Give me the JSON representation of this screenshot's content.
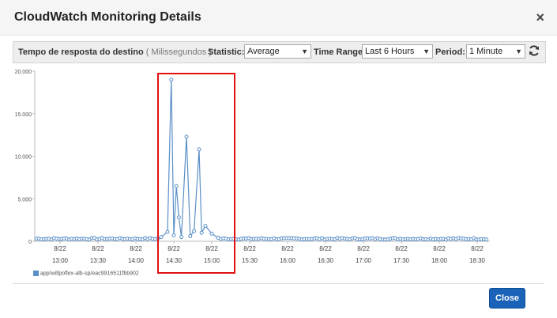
{
  "dialog": {
    "title": "CloudWatch Monitoring Details",
    "close_icon": "×"
  },
  "toolbar": {
    "metric_name": "Tempo de resposta do destino",
    "metric_unit": "( Milissegundos )",
    "statistic_label": "Statistic:",
    "statistic_value": "Average",
    "time_range_label": "Time Range:",
    "time_range_value": "Last 6 Hours",
    "period_label": "Period:",
    "period_value": "1 Minute",
    "refresh_icon": "refresh-icon"
  },
  "legend": {
    "series_name": "app/willpoflex-alb-sp/eac9916511fbb902"
  },
  "footer": {
    "close_label": "Close"
  },
  "colors": {
    "series": "#5b8fc7",
    "highlight": "#e01010",
    "close_button": "#1a63b8"
  },
  "chart_data": {
    "type": "line",
    "xlabel": "",
    "ylabel": "",
    "ylim": [
      0,
      20000
    ],
    "y_ticks": [
      "20.000",
      "15.000",
      "10.000",
      "5.000",
      "0"
    ],
    "x_ticks": [
      {
        "date": "8/22",
        "time": "13:00"
      },
      {
        "date": "8/22",
        "time": "13:30"
      },
      {
        "date": "8/22",
        "time": "14:00"
      },
      {
        "date": "8/22",
        "time": "14:30"
      },
      {
        "date": "8/22",
        "time": "15:00"
      },
      {
        "date": "8/22",
        "time": "15:30"
      },
      {
        "date": "8/22",
        "time": "16:00"
      },
      {
        "date": "8/22",
        "time": "16:30"
      },
      {
        "date": "8/22",
        "time": "17:00"
      },
      {
        "date": "8/22",
        "time": "17:30"
      },
      {
        "date": "8/22",
        "time": "18:00"
      },
      {
        "date": "8/22",
        "time": "18:30"
      }
    ],
    "x_range": [
      "12:40",
      "18:40"
    ],
    "grid": false,
    "legend_position": "bottom-left",
    "series": [
      {
        "name": "app/willpoflex-alb-sp/eac9916511fbb902",
        "baseline": 200,
        "points": [
          {
            "x": "13:00",
            "y": 200
          },
          {
            "x": "13:30",
            "y": 250
          },
          {
            "x": "14:00",
            "y": 200
          },
          {
            "x": "14:20",
            "y": 500
          },
          {
            "x": "14:25",
            "y": 1100
          },
          {
            "x": "14:28",
            "y": 19000
          },
          {
            "x": "14:30",
            "y": 700
          },
          {
            "x": "14:32",
            "y": 6500
          },
          {
            "x": "14:34",
            "y": 2800
          },
          {
            "x": "14:36",
            "y": 500
          },
          {
            "x": "14:40",
            "y": 12300
          },
          {
            "x": "14:43",
            "y": 600
          },
          {
            "x": "14:46",
            "y": 1200
          },
          {
            "x": "14:50",
            "y": 10800
          },
          {
            "x": "14:52",
            "y": 1000
          },
          {
            "x": "14:55",
            "y": 1800
          },
          {
            "x": "15:00",
            "y": 900
          },
          {
            "x": "15:05",
            "y": 400
          },
          {
            "x": "15:30",
            "y": 250
          },
          {
            "x": "16:00",
            "y": 200
          },
          {
            "x": "16:30",
            "y": 250
          },
          {
            "x": "17:00",
            "y": 500
          },
          {
            "x": "17:30",
            "y": 200
          },
          {
            "x": "18:00",
            "y": 250
          },
          {
            "x": "18:30",
            "y": 300
          }
        ]
      }
    ]
  }
}
